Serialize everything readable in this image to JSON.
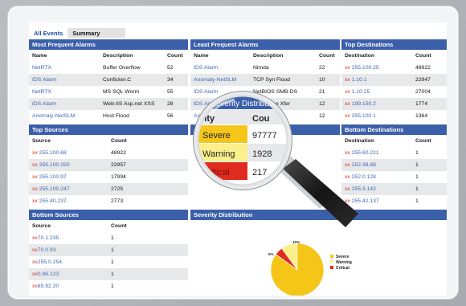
{
  "tabs": [
    {
      "label": "All Events"
    },
    {
      "label": "Summary"
    }
  ],
  "most_frequent_alarms": {
    "title": "Most Frequent Alarms",
    "columns": [
      "Name",
      "Description",
      "Count"
    ],
    "rows": [
      [
        "NetRTX",
        "Buffer Overflow",
        "52"
      ],
      [
        "IDS Alarm",
        "Conficker.C",
        "34"
      ],
      [
        "NetRTX",
        "MS SQL Worm",
        "55"
      ],
      [
        "IDS Alarm",
        "Web-IIS Asp.net XSS",
        "28"
      ],
      [
        "Anomaly-NetSLM",
        "Host Flood",
        "56"
      ]
    ]
  },
  "least_frequent_alarms": {
    "title": "Least Frequest Alarms",
    "columns": [
      "Name",
      "Description",
      "Count"
    ],
    "rows": [
      [
        "IDS Alarm",
        "Nimda",
        "22"
      ],
      [
        "Anomaly-NetSLM",
        "TCP Syn Flood",
        "10"
      ],
      [
        "IDS Alarm",
        "NetBIOS SMB-DS",
        "21"
      ],
      [
        "IDS Alarm",
        "DNS Zone Xfer",
        "12"
      ],
      [
        "Anomaly-NetSLM",
        "Port Scan",
        "12"
      ]
    ]
  },
  "top_destinations": {
    "title": "Top Destinations",
    "columns": [
      "Destination",
      "Count"
    ],
    "rows": [
      [
        "xx",
        "255.100.25",
        "48922"
      ],
      [
        "xx",
        "1.10.1",
        "22947"
      ],
      [
        "xx",
        "1.10.25",
        "27004"
      ],
      [
        "xx",
        "199.150.2",
        "1774"
      ],
      [
        "xx",
        "255.100.1",
        "1364"
      ]
    ]
  },
  "top_sources": {
    "title": "Top Sources",
    "columns": [
      "Source",
      "Count"
    ],
    "rows": [
      [
        "xx",
        "255.100.68",
        "48922"
      ],
      [
        "xx",
        "255.100.250",
        "22957"
      ],
      [
        "xx",
        "255.100.97",
        "17994"
      ],
      [
        "xx",
        "255.100.247",
        "2725"
      ],
      [
        "xx",
        "255.40.237",
        "2773"
      ]
    ]
  },
  "bottom_sources": {
    "title": "Bottom Sources",
    "columns": [
      "Source",
      "Count"
    ],
    "rows": [
      [
        "xx",
        "70.1.235",
        "1"
      ],
      [
        "xx",
        "70.0.93",
        "1"
      ],
      [
        "xx",
        "255.0.254",
        "1"
      ],
      [
        "xx",
        "0.86.123",
        "1"
      ],
      [
        "xx",
        "85.92.20",
        "1"
      ]
    ]
  },
  "bottom_destinations": {
    "title": "Bottom Destinations",
    "columns": [
      "Destination",
      "Count"
    ],
    "rows": [
      [
        "xx",
        "255.60.221",
        "1"
      ],
      [
        "xx",
        "252.38.68",
        "1"
      ],
      [
        "xx",
        "252.0.128",
        "1"
      ],
      [
        "xx",
        "255.3.142",
        "1"
      ],
      [
        "xx",
        "255.42.137",
        "1"
      ]
    ]
  },
  "severity_distribution": {
    "title": "Severity Distribution",
    "chart_data": {
      "type": "pie",
      "categories": [
        "Severe",
        "Warning",
        "Critical"
      ],
      "values": [
        85,
        10,
        5
      ],
      "data_labels": [
        "85%",
        "10%",
        "5%"
      ],
      "colors": [
        "#f5c518",
        "#fbf08b",
        "#e02b20"
      ],
      "legend": "right"
    }
  },
  "magnifier": {
    "header_left": "rity",
    "header_right": "Cou",
    "panel_label_partial": "Severity Distribu",
    "rows": [
      {
        "label": "Severe",
        "value": "97777",
        "color": "#f5c518"
      },
      {
        "label": "Warning",
        "value": "1928",
        "color": "#fbf08b"
      },
      {
        "label": "Critical",
        "value": "217",
        "color": "#e02b20"
      }
    ],
    "anomaly_partial": "Anomaly-"
  },
  "colors": {
    "header_blue": "#3b5fa9",
    "link_blue": "#3d66b4",
    "ip_red": "#d82e1b",
    "row_gray": "#e7e8ea"
  }
}
